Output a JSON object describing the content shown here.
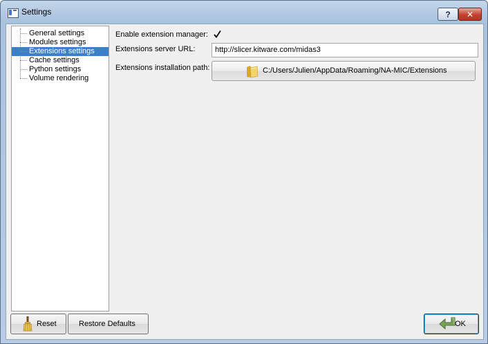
{
  "window": {
    "title": "Settings",
    "help_label": "?",
    "close_label": "✕"
  },
  "sidebar": {
    "items": [
      {
        "label": "General settings",
        "selected": false
      },
      {
        "label": "Modules settings",
        "selected": false
      },
      {
        "label": "Extensions settings",
        "selected": true
      },
      {
        "label": "Cache settings",
        "selected": false
      },
      {
        "label": "Python settings",
        "selected": false
      },
      {
        "label": "Volume rendering",
        "selected": false
      }
    ]
  },
  "form": {
    "enable_label": "Enable extension manager:",
    "enable_checked": true,
    "server_label": "Extensions server URL:",
    "server_value": "http://slicer.kitware.com/midas3",
    "path_label": "Extensions installation path:",
    "path_value": "C:/Users/Julien/AppData/Roaming/NA-MIC/Extensions",
    "path_icon": "folder-icon"
  },
  "footer": {
    "reset_label": "Reset",
    "reset_icon": "broom-icon",
    "restore_label": "Restore Defaults",
    "ok_label": "OK",
    "ok_icon": "ok-arrow-icon"
  },
  "colors": {
    "selection": "#3e80c6",
    "titlebar": "#b8cde5",
    "close": "#c4402f"
  }
}
